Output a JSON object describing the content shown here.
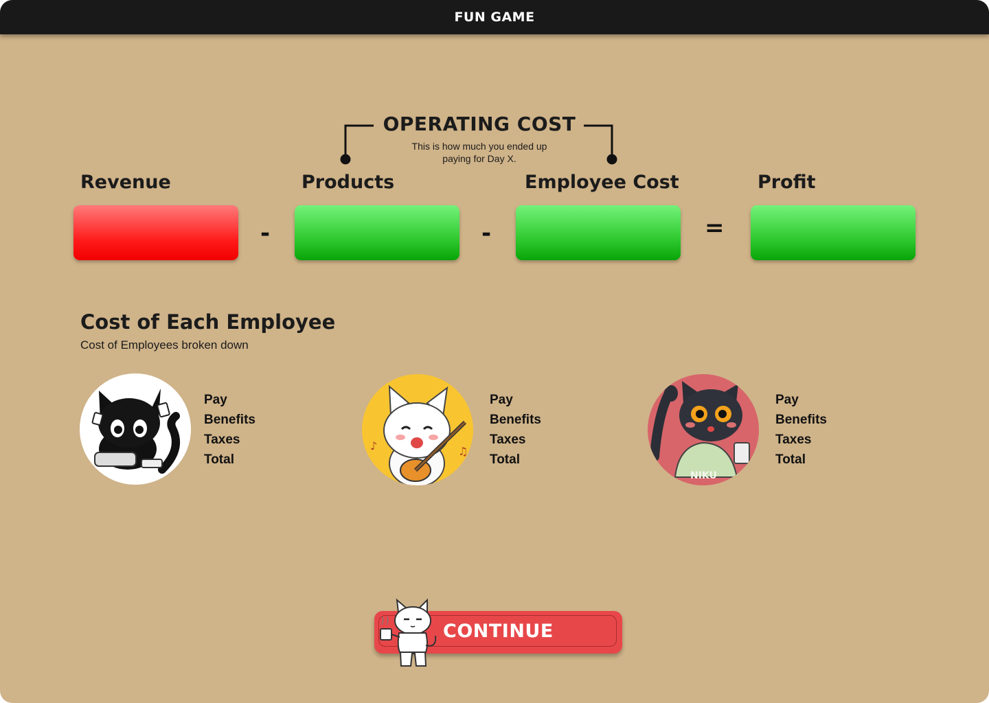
{
  "window": {
    "title": "FUN GAME"
  },
  "operating_cost": {
    "title": "OPERATING COST",
    "subtitle_line1": "This is how much you ended up",
    "subtitle_line2": "paying for Day X."
  },
  "equation": {
    "revenue_label": "Revenue",
    "products_label": "Products",
    "employee_cost_label": "Employee Cost",
    "profit_label": "Profit",
    "minus": "-",
    "equals": "=",
    "colors": {
      "red": "#FF1A1A",
      "green": "#2CC72C"
    }
  },
  "employees_section": {
    "title": "Cost of Each Employee",
    "subtitle": "Cost of Employees broken down",
    "employees": [
      {
        "avatar_icon": "black-cat-gamer-icon",
        "lines": [
          "Pay",
          "Benefits",
          "Taxes",
          "Total"
        ]
      },
      {
        "avatar_icon": "white-cat-guitar-icon",
        "lines": [
          "Pay",
          "Benefits",
          "Taxes",
          "Total"
        ]
      },
      {
        "avatar_icon": "black-cat-hoodie-icon",
        "lines": [
          "Pay",
          "Benefits",
          "Taxes",
          "Total"
        ]
      }
    ]
  },
  "continue_button": {
    "label": "CONTINUE",
    "mascot_icon": "coffee-cat-icon",
    "color": "#E8474A"
  }
}
